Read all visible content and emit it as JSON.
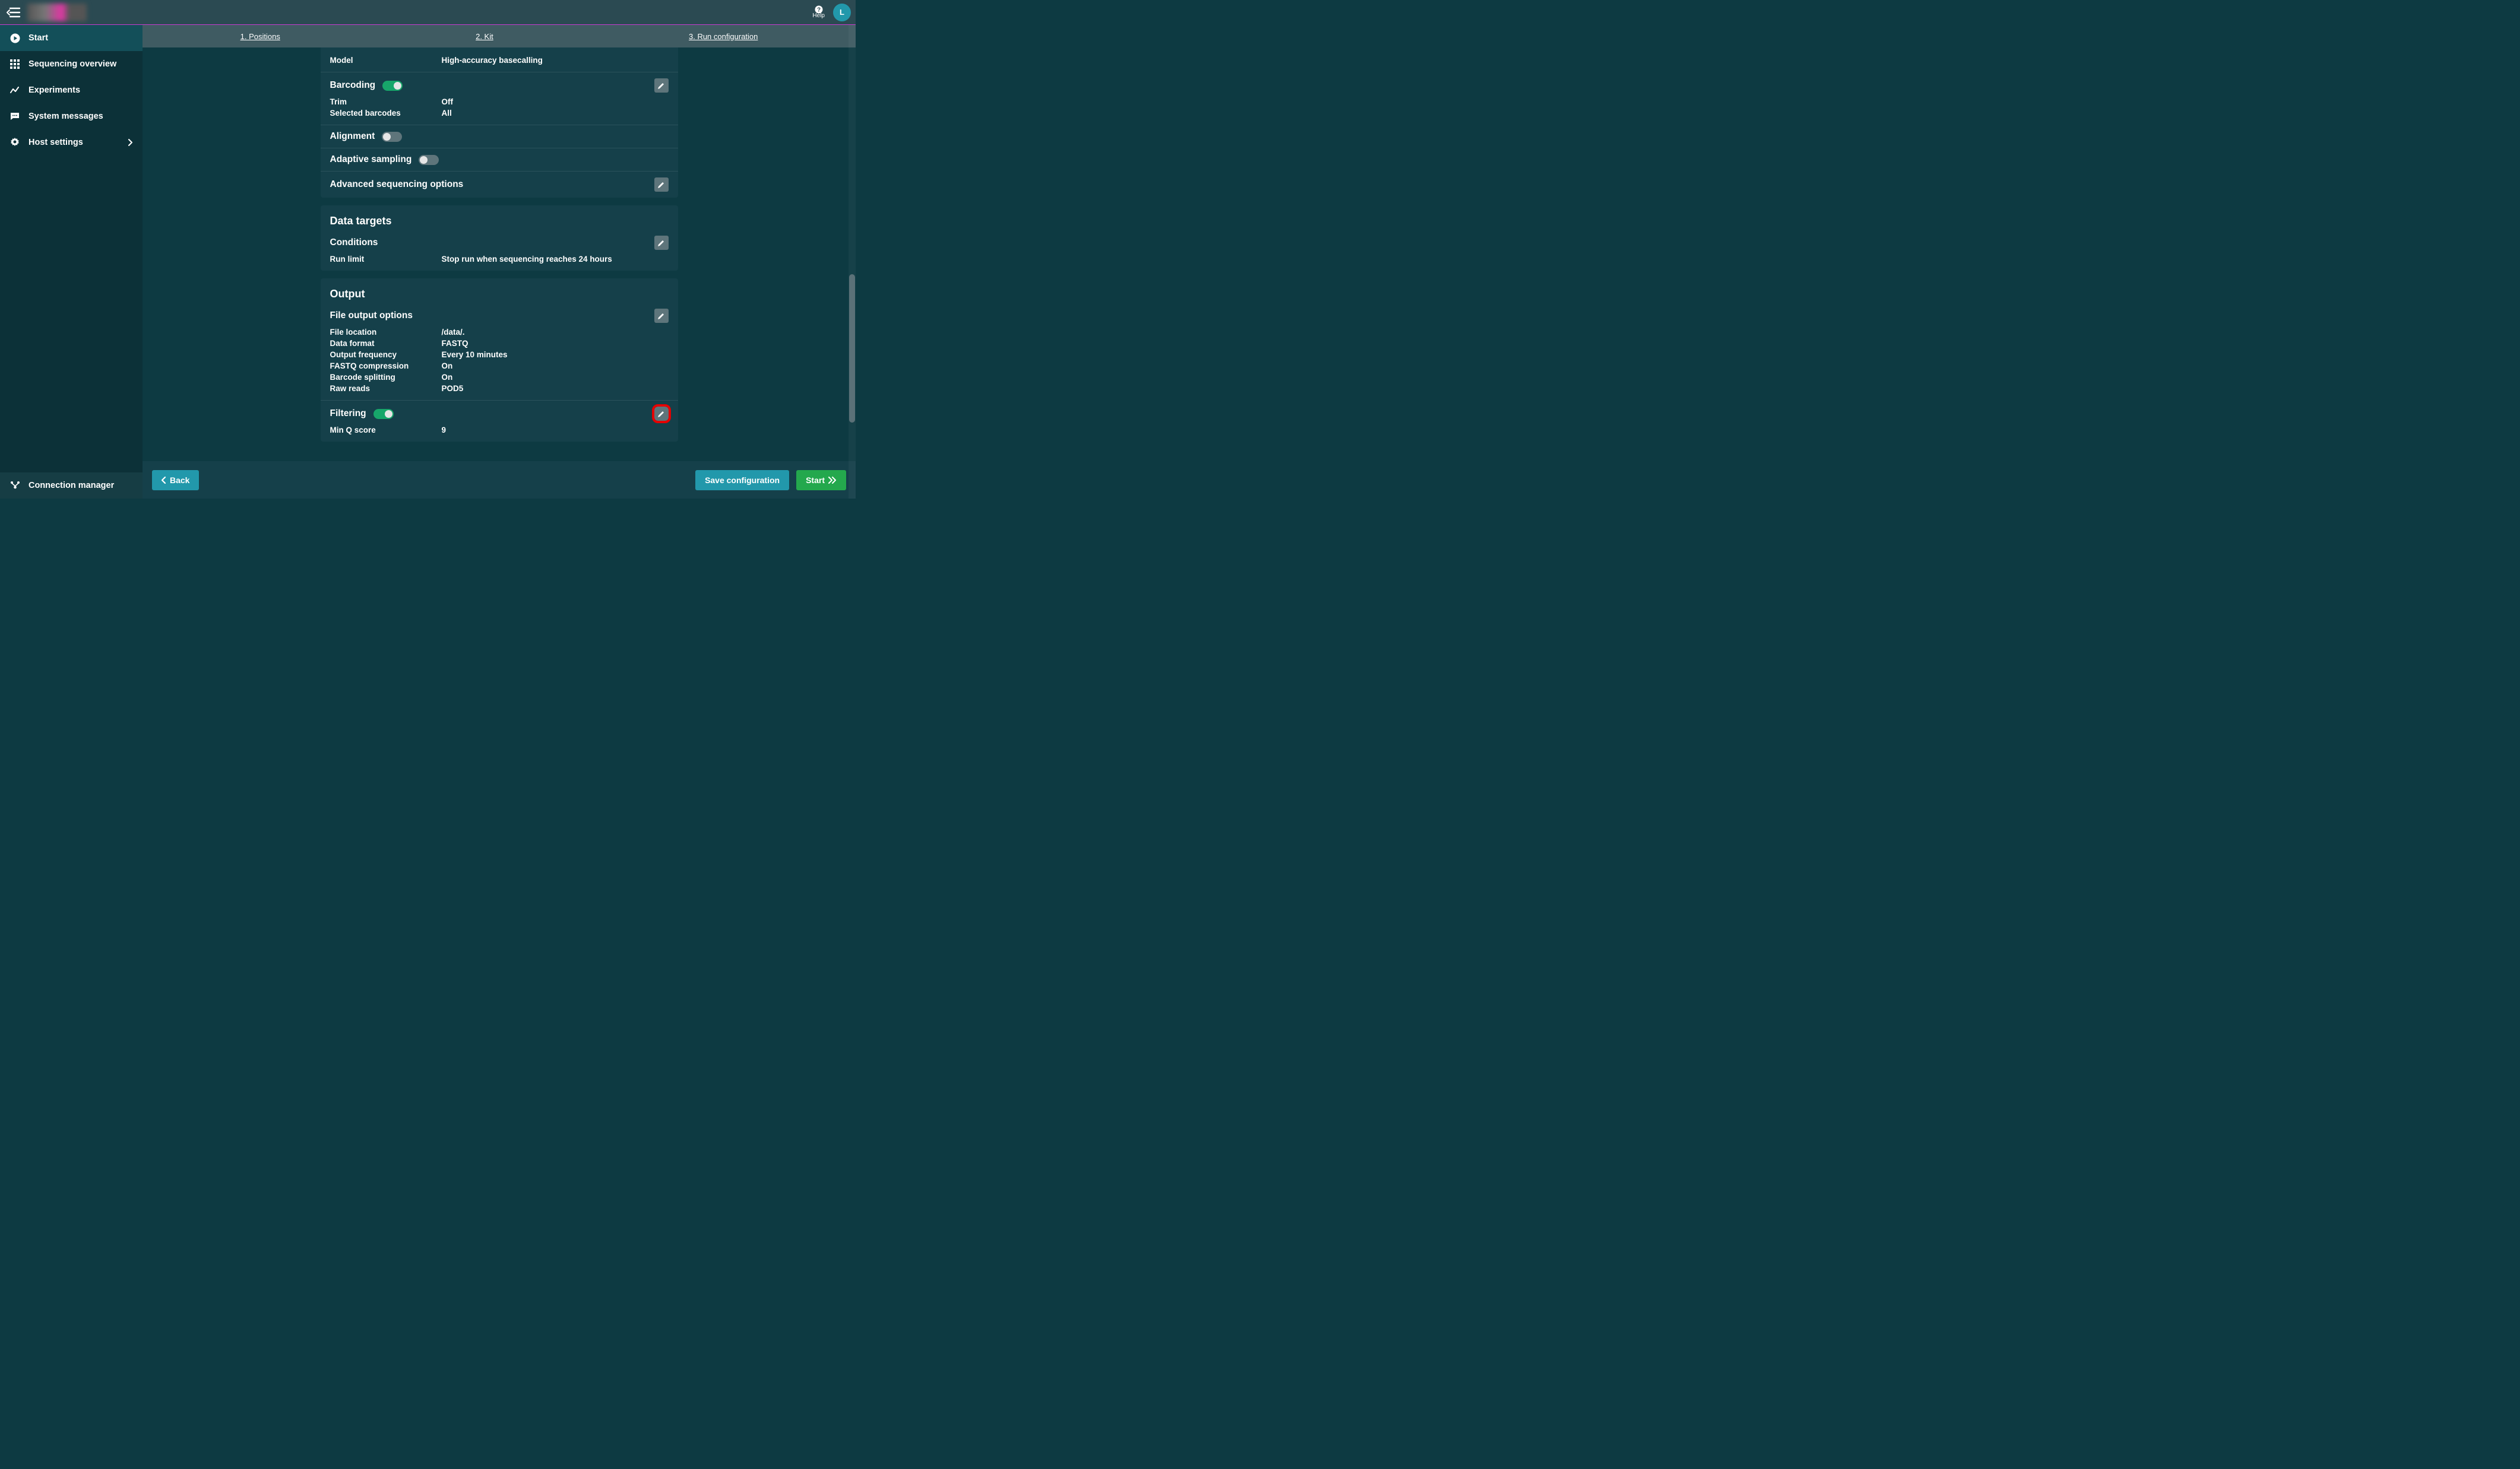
{
  "topbar": {
    "help_label": "Help",
    "avatar_initial": "L"
  },
  "sidebar": {
    "items": [
      {
        "label": "Start"
      },
      {
        "label": "Sequencing overview"
      },
      {
        "label": "Experiments"
      },
      {
        "label": "System messages"
      },
      {
        "label": "Host settings"
      }
    ],
    "bottom": {
      "label": "Connection manager"
    }
  },
  "steps": {
    "s1": "1. Positions",
    "s2": "2. Kit",
    "s3": "3. Run configuration"
  },
  "panel_basecall": {
    "model_label": "Model",
    "model_value": "High-accuracy basecalling",
    "barcoding_label": "Barcoding",
    "trim_label": "Trim",
    "trim_value": "Off",
    "selected_barcodes_label": "Selected barcodes",
    "selected_barcodes_value": "All",
    "alignment_label": "Alignment",
    "adaptive_label": "Adaptive sampling",
    "advanced_label": "Advanced sequencing options"
  },
  "panel_targets": {
    "title": "Data targets",
    "conditions_label": "Conditions",
    "runlimit_label": "Run limit",
    "runlimit_value": "Stop run when sequencing reaches 24 hours"
  },
  "panel_output": {
    "title": "Output",
    "file_output_label": "File output options",
    "rows": {
      "file_location_label": "File location",
      "file_location_value": "/data/.",
      "data_format_label": "Data format",
      "data_format_value": "FASTQ",
      "output_freq_label": "Output frequency",
      "output_freq_value": "Every 10 minutes",
      "fastq_comp_label": "FASTQ compression",
      "fastq_comp_value": "On",
      "barcode_split_label": "Barcode splitting",
      "barcode_split_value": "On",
      "raw_reads_label": "Raw reads",
      "raw_reads_value": "POD5"
    },
    "filtering_label": "Filtering",
    "minq_label": "Min Q score",
    "minq_value": "9"
  },
  "footer": {
    "back": "Back",
    "save": "Save configuration",
    "start": "Start"
  }
}
